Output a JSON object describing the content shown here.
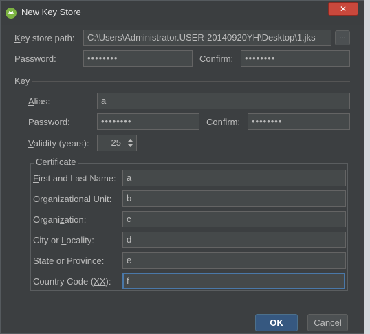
{
  "window": {
    "title": "New Key Store",
    "close_label": "✕"
  },
  "keystore": {
    "path_label_mnemonic": "K",
    "path_label_rest": "ey store path:",
    "path_value": "C:\\Users\\Administrator.USER-20140920YH\\Desktop\\1.jks",
    "browse_label": "...",
    "password_label_mnemonic": "P",
    "password_label_rest": "assword:",
    "password_value": "••••••••",
    "confirm_label_pre": "Co",
    "confirm_label_mnemonic": "n",
    "confirm_label_post": "firm:",
    "confirm_value": "••••••••"
  },
  "key": {
    "section_label": "Key",
    "alias_label_mnemonic": "A",
    "alias_label_rest": "lias:",
    "alias_value": "a",
    "password_label_pre": "Pa",
    "password_label_mnemonic": "s",
    "password_label_post": "sword:",
    "password_value": "••••••••",
    "confirm_label_mnemonic": "C",
    "confirm_label_rest": "onfirm:",
    "confirm_value": "••••••••",
    "validity_label_mnemonic": "V",
    "validity_label_rest": "alidity (years):",
    "validity_value": "25"
  },
  "certificate": {
    "group_label": "Certificate",
    "fields": [
      {
        "label_mnemonic": "F",
        "label_rest": "irst and Last Name:",
        "value": "a"
      },
      {
        "label_mnemonic": "O",
        "label_rest": "rganizational Unit:",
        "value": "b"
      },
      {
        "label_pre": "Organi",
        "label_mnemonic": "z",
        "label_rest": "ation:",
        "value": "c"
      },
      {
        "label_pre": "City or ",
        "label_mnemonic": "L",
        "label_rest": "ocality:",
        "value": "d"
      },
      {
        "label_pre": "State or Provin",
        "label_mnemonic": "c",
        "label_rest": "e:",
        "value": "e"
      },
      {
        "label_pre": "Country Code (",
        "label_mnemonic": "XX",
        "label_rest": "):",
        "value": "f"
      }
    ]
  },
  "buttons": {
    "ok_label": "OK",
    "cancel_label": "Cancel"
  }
}
